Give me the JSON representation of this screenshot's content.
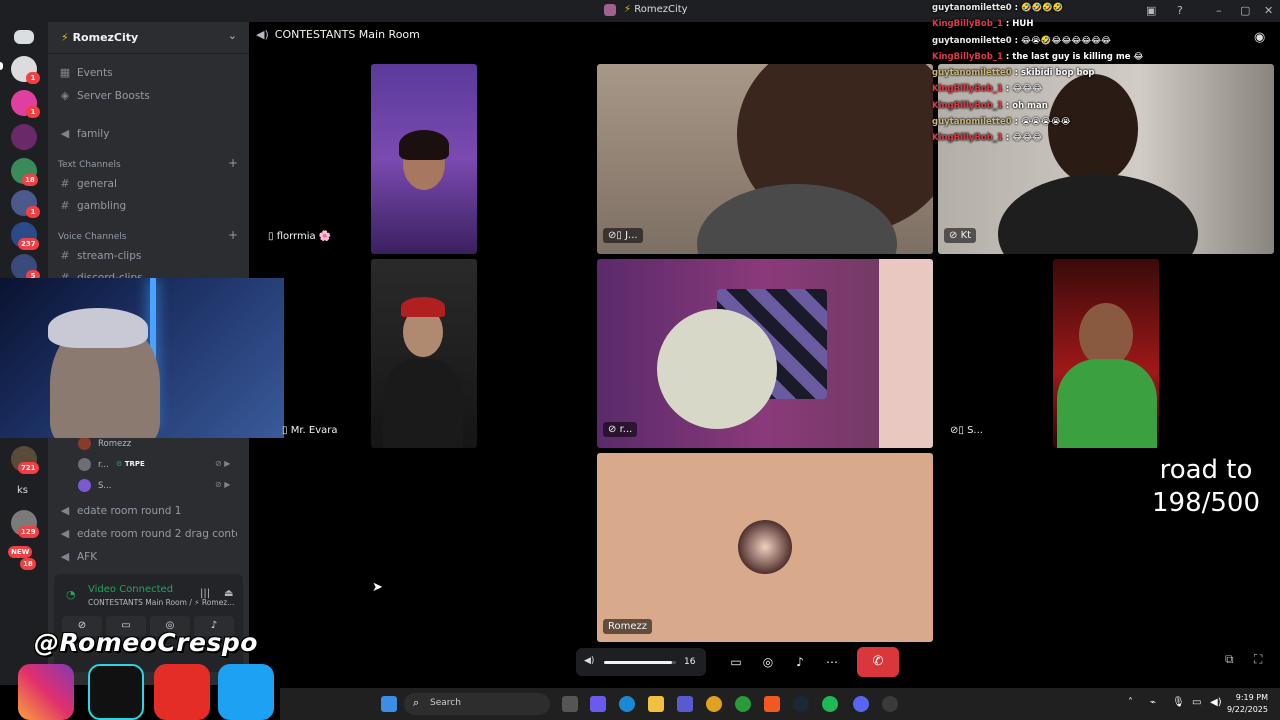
{
  "window": {
    "title": "RomezCity",
    "minimize_glyph": "–",
    "maximize_glyph": "▢",
    "close_glyph": "✕"
  },
  "servers": {
    "badges": [
      "1",
      "1",
      "18",
      "1",
      "237",
      "5",
      "721",
      "129",
      "18"
    ],
    "text_server": "ks",
    "new_label": "NEW"
  },
  "sidebar": {
    "guild_name": "RomezCity",
    "guild_prefix_glyph": "⚡",
    "items": [
      {
        "label": "Events",
        "icon": "calendar-icon"
      },
      {
        "label": "Server Boosts",
        "icon": "boost-icon"
      },
      {
        "label": "family",
        "icon": "voice-icon"
      }
    ],
    "text_channels_label": "Text Channels",
    "text_channels": [
      "general",
      "gambling"
    ],
    "voice_channels_label": "Voice Channels",
    "voice_channels": [
      "stream-clips",
      "discord-clips"
    ],
    "voice_users": [
      {
        "name": "Romezz",
        "tag": ""
      },
      {
        "name": "r...",
        "tag": "TRPE"
      },
      {
        "name": "S...",
        "tag": ""
      }
    ],
    "other_voice": [
      "edate room round 1",
      "edate room round 2 drag contes...",
      "AFK"
    ]
  },
  "voice_panel": {
    "status": "Video Connected",
    "sub": "CONTESTANTS Main Room / ⚡ Romez...",
    "buttons": [
      "video-off-icon",
      "screenshare-icon",
      "activity-icon",
      "soundboard-icon"
    ]
  },
  "call": {
    "header": "CONTESTANTS Main Room",
    "tiles": [
      {
        "label": "florrmia 🌸",
        "icon": "phone-icon"
      },
      {
        "label": "J...",
        "icon": "mute-phone-icon"
      },
      {
        "label": "Kt",
        "icon": "mute-icon"
      },
      {
        "label": "Mr. Evara",
        "icon": "phone-icon"
      },
      {
        "label": "r...",
        "icon": "mute-icon"
      },
      {
        "label": "S...",
        "icon": "mute-phone-icon"
      },
      {
        "label": "Romezz",
        "icon": ""
      }
    ]
  },
  "chat": [
    {
      "user": "guytanomilette0",
      "role": "u1",
      "msg": "🤣🤣🤣🤣"
    },
    {
      "user": "KingBillyBob_1",
      "role": "u2",
      "msg": "HUH"
    },
    {
      "user": "guytanomilette0",
      "role": "u1",
      "msg": "😂😭🤣😂😂😂😂😂😂"
    },
    {
      "user": "KingBillyBob_1",
      "role": "u2",
      "msg": "the last guy is killing me 😂"
    },
    {
      "user": "guytanomilette0",
      "role": "u3",
      "msg": "skibidi bop bop"
    },
    {
      "user": "KingBillyBob_1",
      "role": "u2",
      "msg": "😂😂😂"
    },
    {
      "user": "KingBillyBob_1",
      "role": "u2",
      "msg": "oh man"
    },
    {
      "user": "guytanomilette0",
      "role": "u3",
      "msg": "😭😭😭😭😭"
    },
    {
      "user": "KingBillyBob_1",
      "role": "u2",
      "msg": "😂😂😂"
    }
  ],
  "goal": {
    "line1": "road to",
    "line2": "198/500"
  },
  "controls": {
    "volume": "16",
    "volume_fraction": 0.95,
    "buttons": [
      "screenshare-icon",
      "activity-icon",
      "soundboard-icon",
      "more-icon"
    ],
    "hangup_glyph": "✆"
  },
  "overlay": {
    "handle": "@RomeoCrespo"
  },
  "taskbar": {
    "search_placeholder": "Search",
    "time": "9:19 PM",
    "date": "9/22/2025"
  },
  "colors": {
    "accent": "#5865f2",
    "green": "#23a55a",
    "danger": "#da373c"
  }
}
